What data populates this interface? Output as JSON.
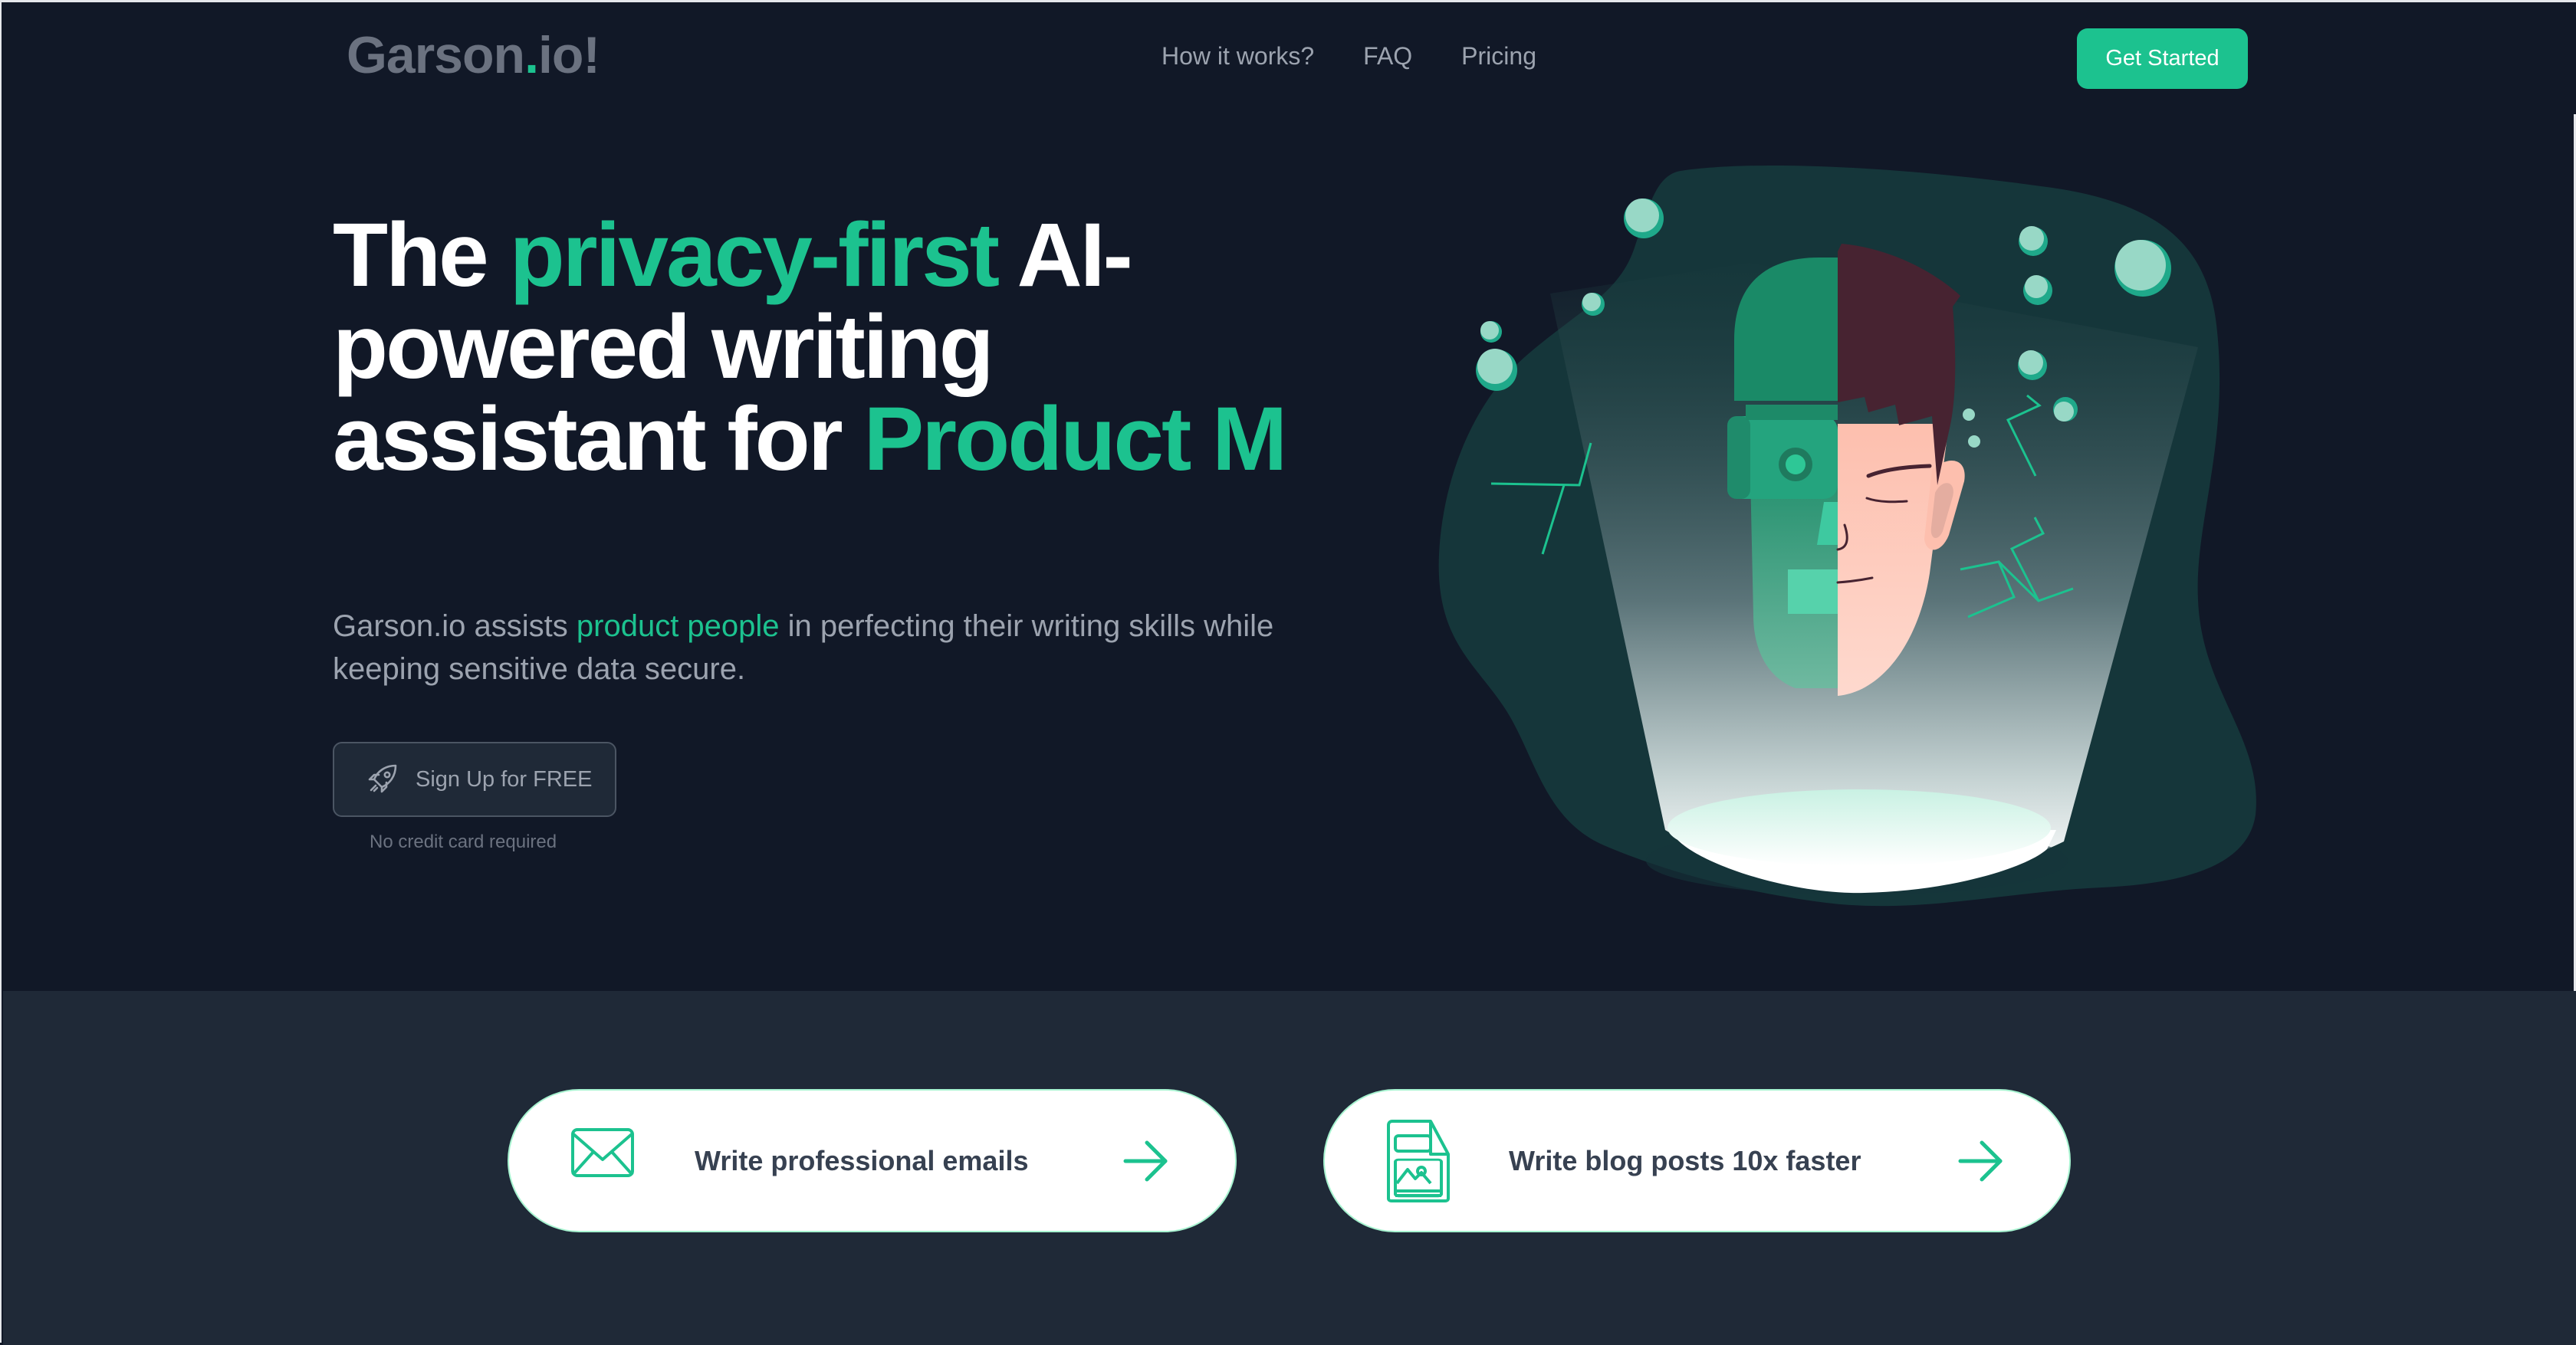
{
  "header": {
    "logo": {
      "text_main": "Garson",
      "text_dot": ".",
      "text_tail": "io!"
    },
    "nav": [
      {
        "label": "How it works?"
      },
      {
        "label": "FAQ"
      },
      {
        "label": "Pricing"
      }
    ],
    "cta_label": "Get Started"
  },
  "hero": {
    "headline": {
      "part1": "The ",
      "accent1": "privacy-first",
      "part2": " AI-powered writing assistant for ",
      "accent2": "Product M"
    },
    "subtitle": {
      "part1": "Garson.io assists ",
      "accent": "product people",
      "part2": " in perfecting their writing skills while keeping sensitive data secure."
    },
    "signup_label": "Sign Up for FREE",
    "signup_icon": "rocket-icon",
    "note": "No credit card required",
    "illustration": "half-robot-half-human-head"
  },
  "features": [
    {
      "label": "Write professional emails",
      "icon": "envelope-icon"
    },
    {
      "label": "Write blog posts 10x faster",
      "icon": "document-image-icon"
    }
  ],
  "colors": {
    "accent": "#1cc28f",
    "background": "#111827",
    "lower_background": "#1f2937",
    "muted_text": "#9ca3af",
    "logo_gray": "#6b7280"
  }
}
